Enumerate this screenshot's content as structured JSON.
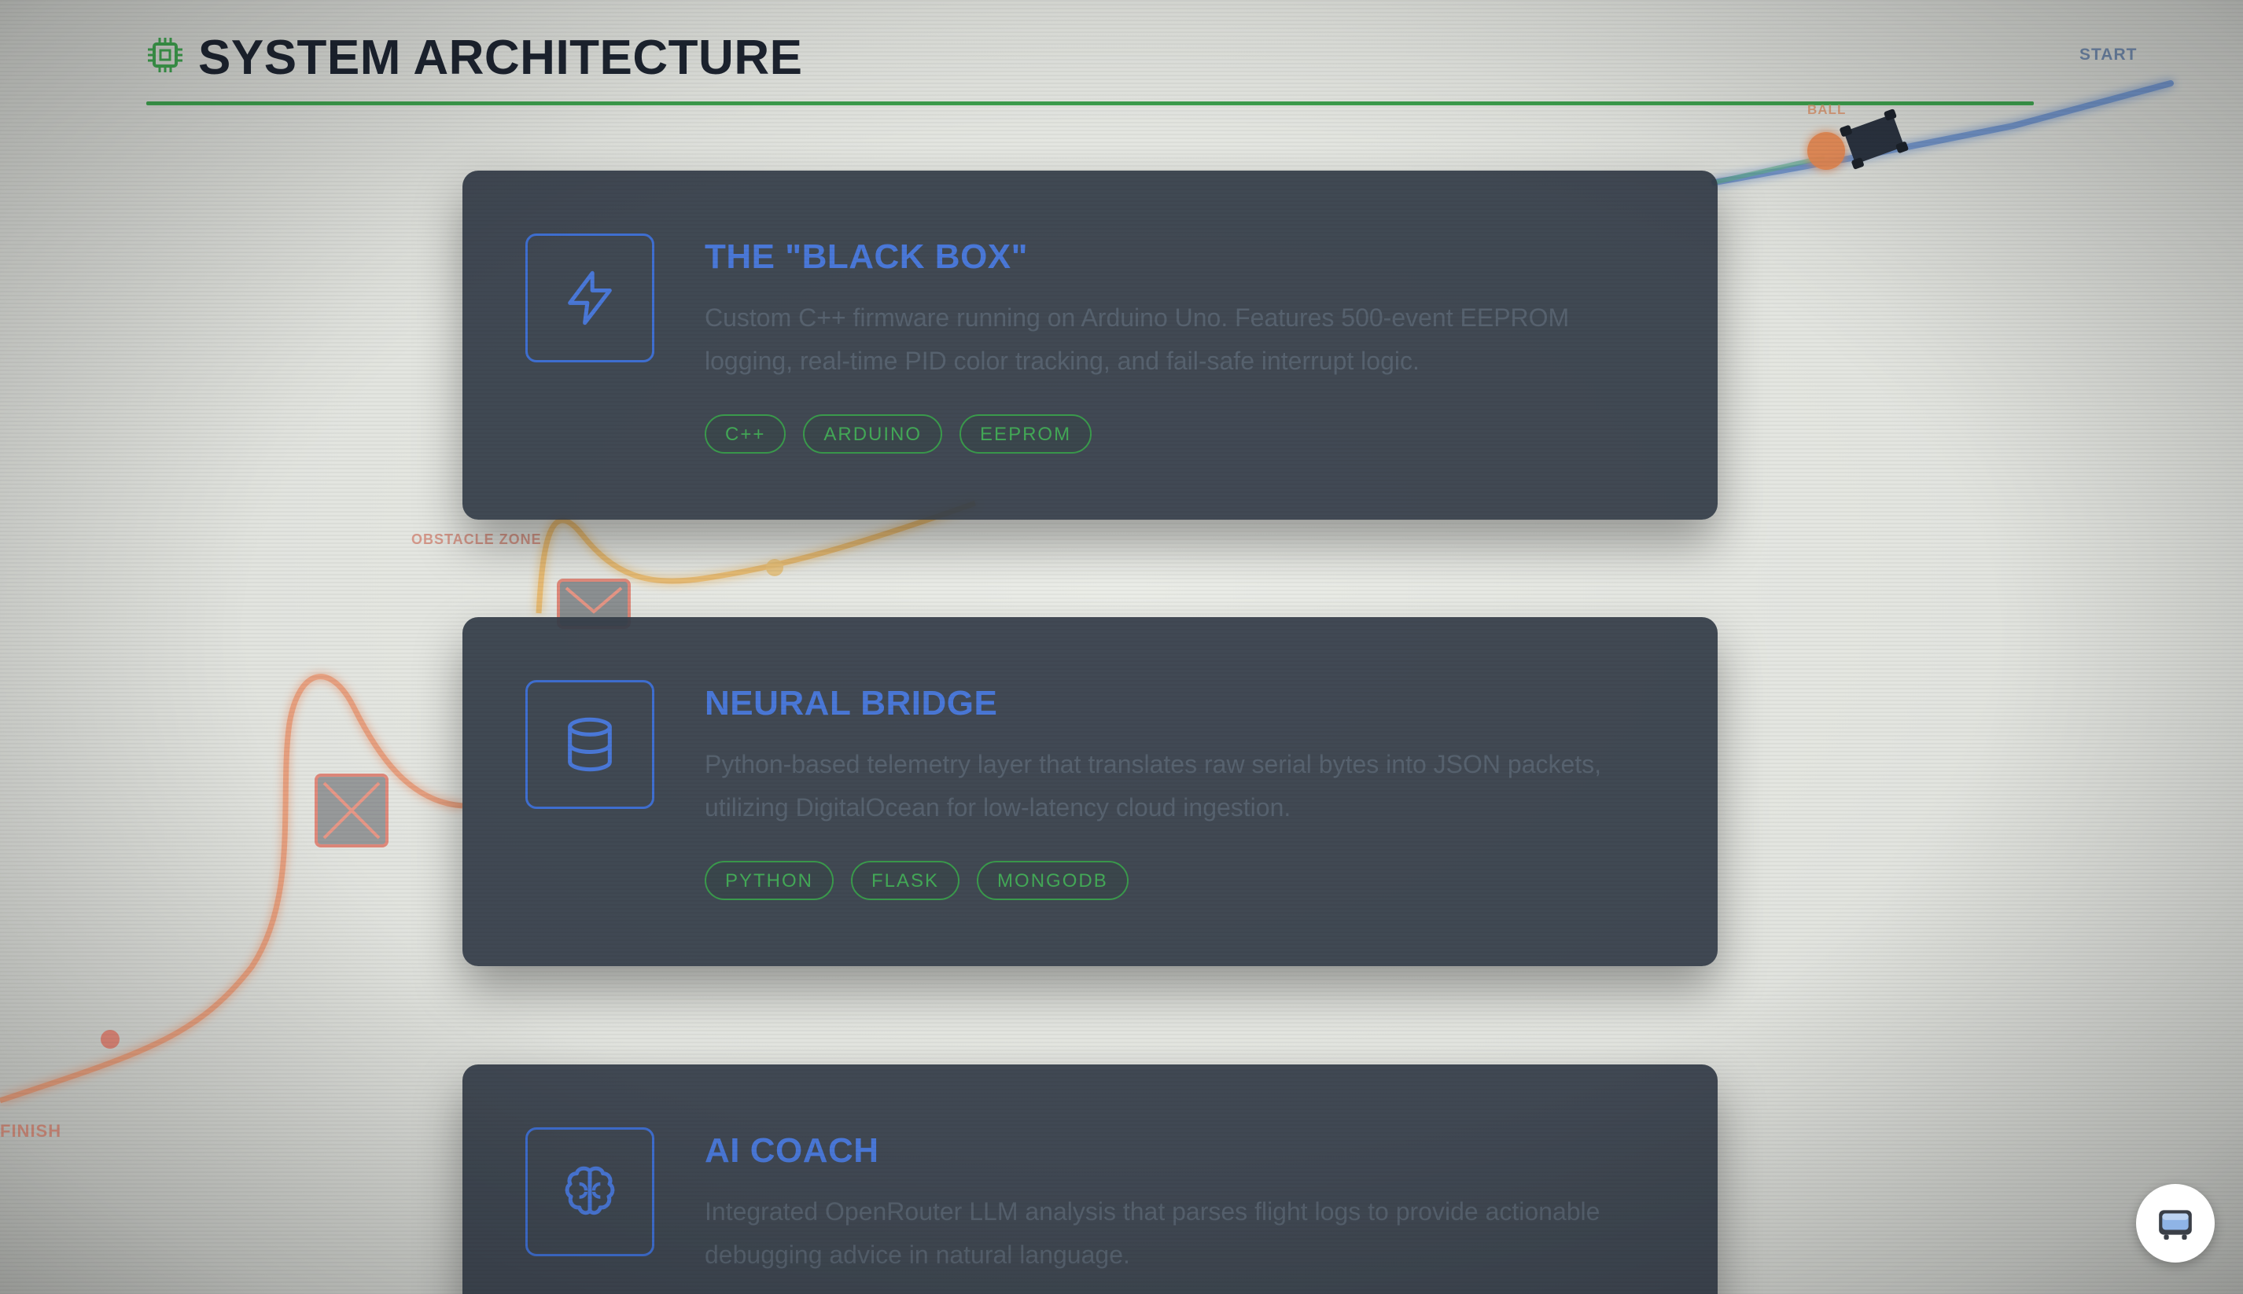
{
  "header": {
    "title": "SYSTEM ARCHITECTURE",
    "icon": "cpu-chip-icon"
  },
  "track": {
    "start_label": "START",
    "ball_label": "BALL",
    "obstacle_label": "OBSTACLE ZONE",
    "finish_label": "FINISH"
  },
  "cards": [
    {
      "title": "THE \"BLACK BOX\"",
      "icon": "lightning-bolt-icon",
      "description": "Custom C++ firmware running on Arduino Uno. Features 500-event EEPROM logging, real-time PID color tracking, and fail-safe interrupt logic.",
      "tags": [
        "C++",
        "ARDUINO",
        "EEPROM"
      ]
    },
    {
      "title": "NEURAL BRIDGE",
      "icon": "database-icon",
      "description": "Python-based telemetry layer that translates raw serial bytes into JSON packets, utilizing DigitalOcean for low-latency cloud ingestion.",
      "tags": [
        "PYTHON",
        "FLASK",
        "MONGODB"
      ]
    },
    {
      "title": "AI COACH",
      "icon": "brain-icon",
      "description": "Integrated OpenRouter LLM analysis that parses flight logs to provide actionable debugging advice in natural language.",
      "tags": []
    }
  ],
  "floating_button": {
    "icon": "retro-tv-icon"
  },
  "colors": {
    "accent_blue": "#4a78d8",
    "accent_green": "#3ea04e",
    "card_bg": "#343c48",
    "track_orange": "#e59a55",
    "track_red": "#e07a5f"
  }
}
